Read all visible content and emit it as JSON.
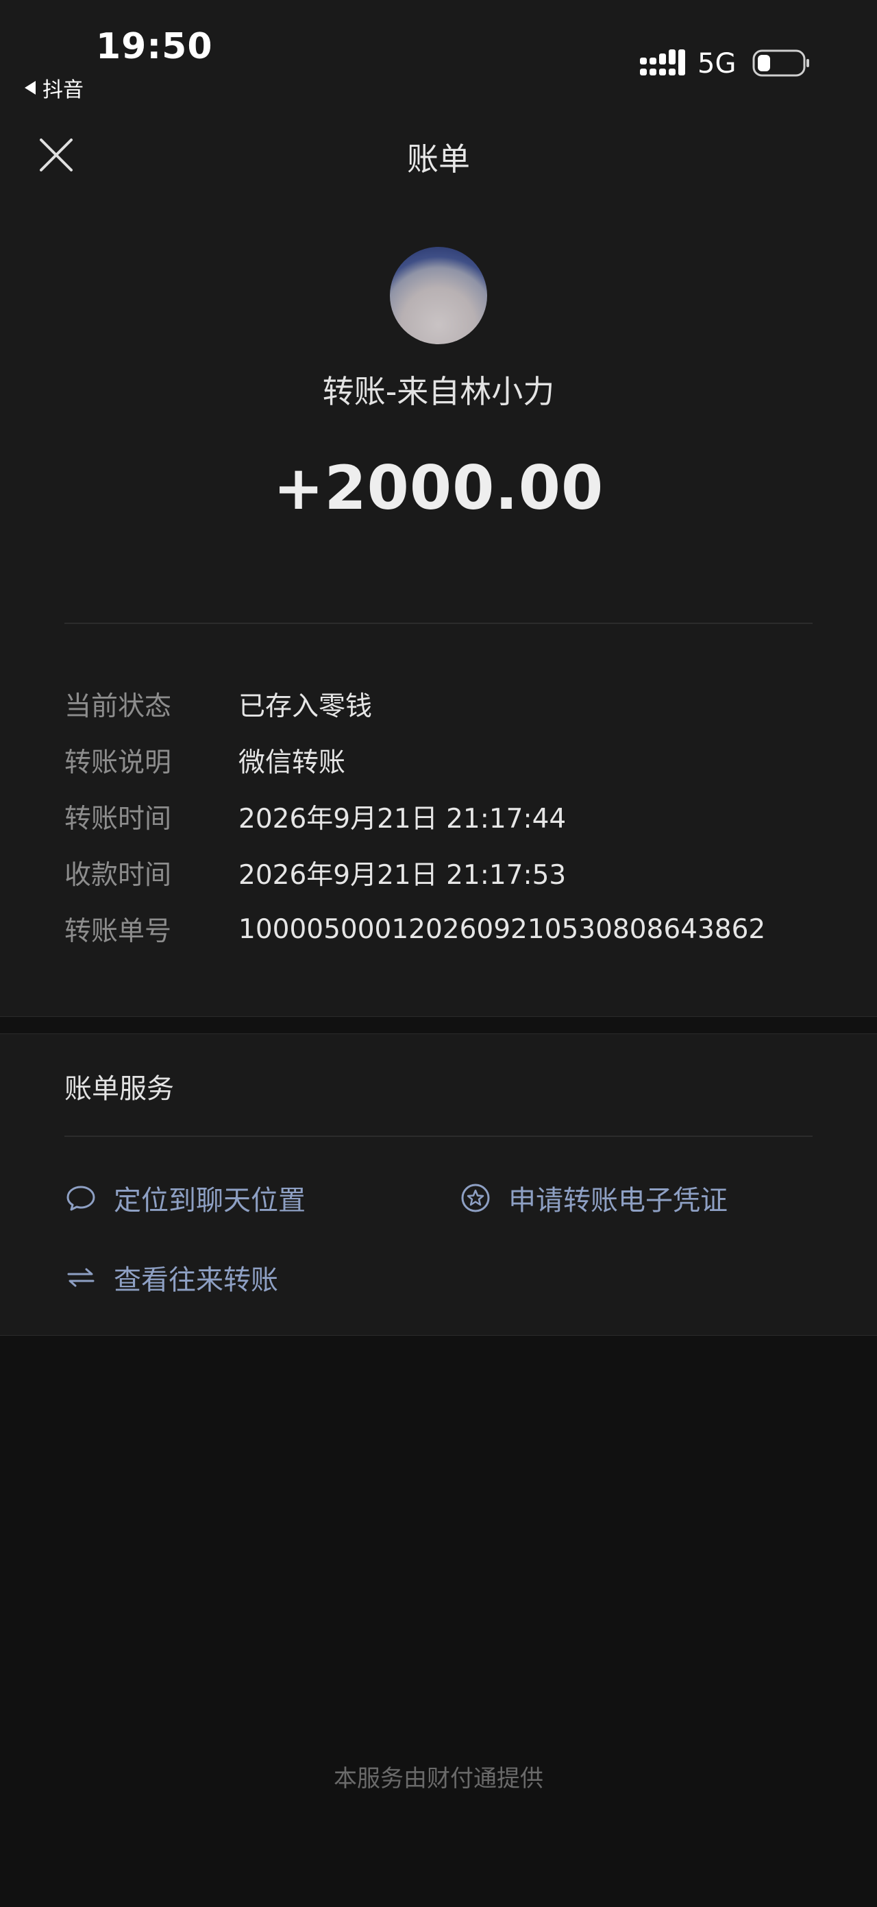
{
  "status_bar": {
    "time": "19:50",
    "back_app": "抖音",
    "network": "5G"
  },
  "header": {
    "title": "账单"
  },
  "transfer": {
    "from_text": "转账-来自林小力",
    "amount": "+2000.00"
  },
  "details": [
    {
      "label": "当前状态",
      "value": "已存入零钱"
    },
    {
      "label": "转账说明",
      "value": "微信转账"
    },
    {
      "label": "转账时间",
      "value": "2026年9月21日 21:17:44"
    },
    {
      "label": "收款时间",
      "value": "2026年9月21日 21:17:53"
    },
    {
      "label": "转账单号",
      "value": "1000050001202609210530808643862"
    }
  ],
  "service": {
    "title": "账单服务",
    "items": [
      {
        "label": "定位到聊天位置",
        "icon": "chat-bubble-icon"
      },
      {
        "label": "申请转账电子凭证",
        "icon": "star-badge-icon"
      },
      {
        "label": "查看往来转账",
        "icon": "transfer-arrows-icon"
      }
    ]
  },
  "footer": {
    "text": "本服务由财付通提供"
  },
  "colors": {
    "background": "#111111",
    "panel": "#1a1a1a",
    "link": "#8ea0c4",
    "label": "#8d8d8d"
  }
}
